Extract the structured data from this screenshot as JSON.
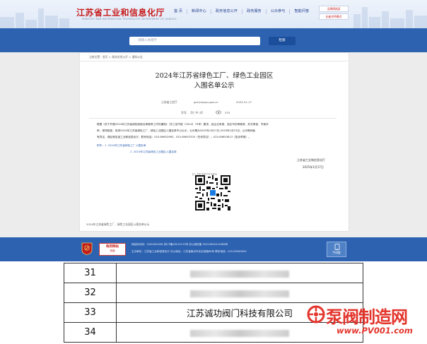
{
  "header": {
    "site_title": "江苏省工业和信息化厅",
    "site_subtitle": "MINISTRY AND INFORMATION TECHNOLOGY DEPARTMENT OF JIANGSU",
    "nav": [
      "首 页",
      "新闻中心",
      "政务信息公开",
      "政务服务",
      "公众参与",
      "智能问答"
    ],
    "right_buttons": [
      "无障碍阅读",
      "长者关怀模式"
    ]
  },
  "search": {
    "placeholder": "请输入关键字",
    "button_label": "检索"
  },
  "article": {
    "breadcrumb": "当前位置：首页 > 政务信息公开 > 通知公告",
    "title_lines": [
      "2024年江苏省绿色工厂、绿色工业园区",
      "入围名单公示"
    ],
    "meta_source": "江苏省工信厅",
    "meta_url": "gxt.jiangsu.gov.cn",
    "meta_date": "2025-01-17",
    "meta_font": "字号：【大 中 小】",
    "meta_views": "370",
    "body_lines": [
      "根据《关于开展2024年江苏省绿色制造名单推荐工作的通知》（苏工信节能〔2024〕79号）要求，经企业申报、设区市初审推荐、形式审查、专家评",
      "审、现场核查，拟将2024年江苏省绿色工厂、绿色工业园区入围名单予以公示，公示期为2025年1月17日-2025年1月23日。公示期间如",
      "有异议，请反映至省工业和信息化厅。联系电话：025-69652963、025-69653700（任何异议）；025-69653813（投诉举报）。"
    ],
    "attachments_label": "附件：1. 2024年江苏省绿色工厂入围名单",
    "attachment_2": "2. 2024年江苏省绿色工业园区入围名单",
    "signature_org": "江苏省工业和信息化厅",
    "signature_date": "2025年1月17日",
    "qr_caption": "扫一扫在手机打开当前页",
    "bottom_note": "2024年江苏省绿色工厂、绿色工业园区入围名单公示"
  },
  "footer": {
    "badge_top": "政府网站",
    "badge_bottom": "找错",
    "line1": "网站标识码：3200000006   苏ICP备05010170号   苏公网安备 32010602010386号",
    "line2": "主办单位：江苏省工业和信息化厅   办公地址：江苏省南京市北京西路68号 联系电话：025-83383000",
    "mobile_label": "手机版"
  },
  "table": {
    "rows": [
      {
        "num": "31",
        "name": ""
      },
      {
        "num": "32",
        "name": ""
      },
      {
        "num": "33",
        "name": "江苏诚功阀门科技有限公司"
      },
      {
        "num": "34",
        "name": ""
      }
    ]
  },
  "watermark": {
    "brand": "泵阀制造网",
    "url": "www.PV001.com"
  }
}
